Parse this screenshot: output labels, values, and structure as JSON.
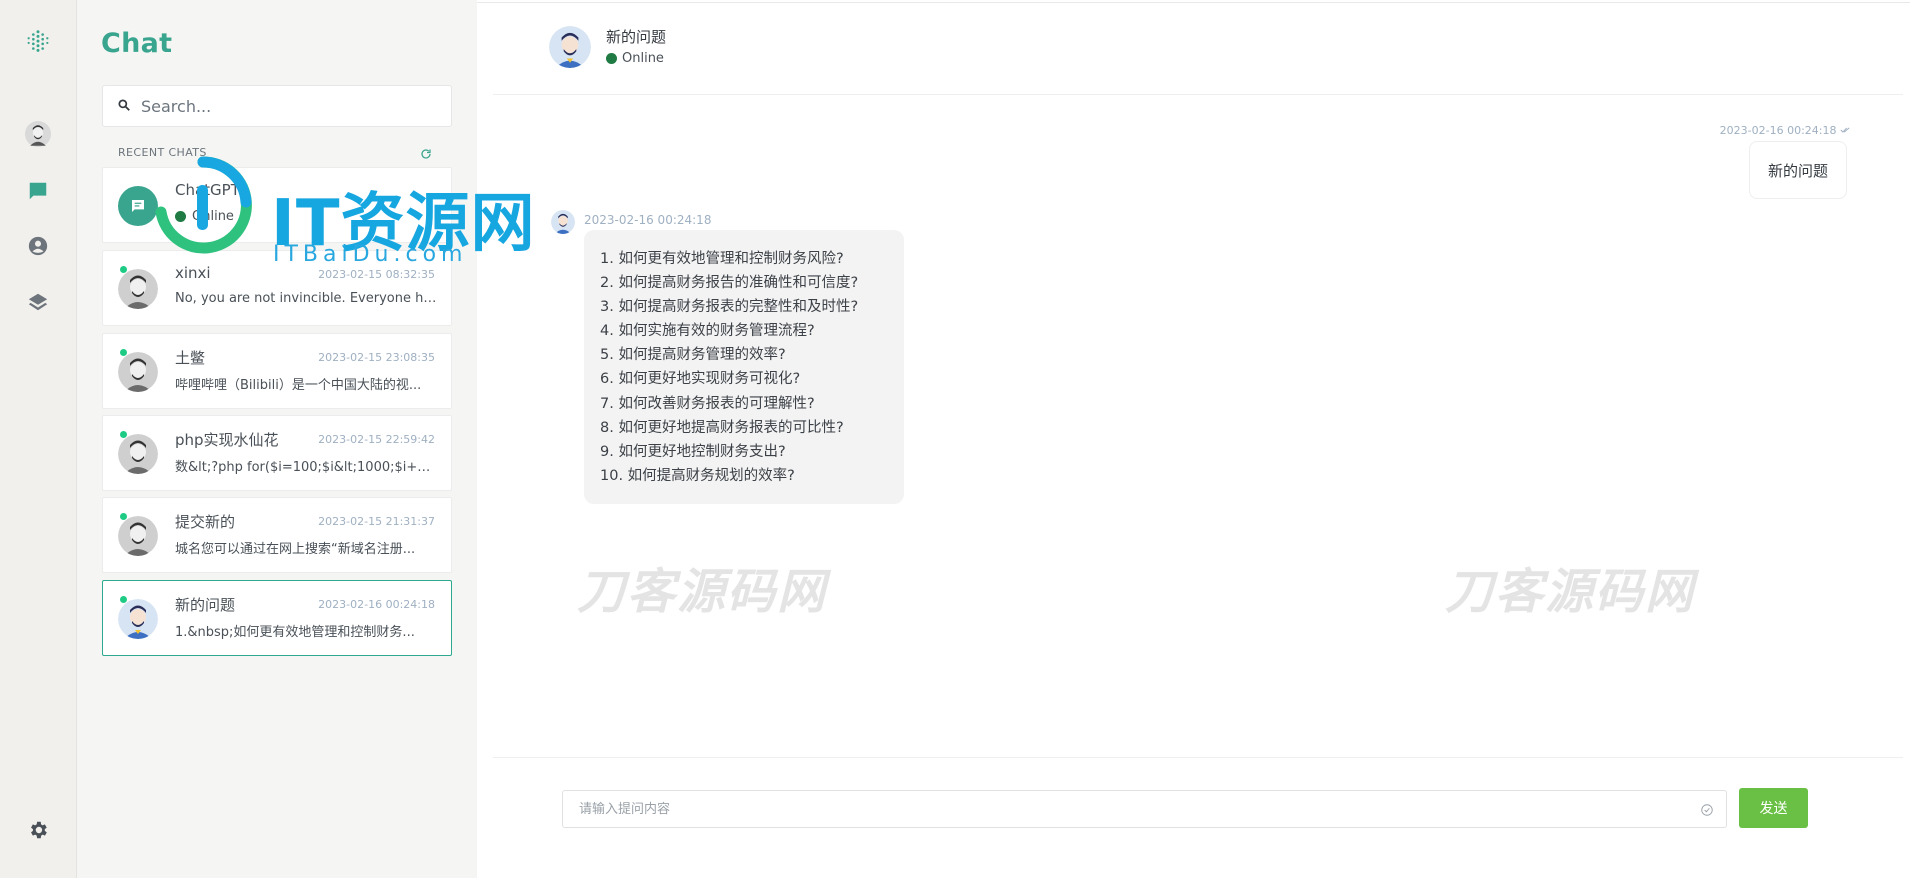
{
  "colors": {
    "accent": "#3aa58f",
    "send": "#6ac044",
    "online": "#1f7a43",
    "unread_dot": "#1ecb84"
  },
  "rail": {
    "icons": [
      "brand-icon",
      "profile-avatar",
      "chat-icon",
      "user-circle-icon",
      "layers-icon",
      "settings-icon"
    ]
  },
  "panel": {
    "title": "Chat",
    "search_placeholder": "Search...",
    "recent_label": "RECENT CHATS",
    "chats": [
      {
        "name": "ChatGPT",
        "status": "Online",
        "type": "bot"
      },
      {
        "name": "xinxi",
        "time": "2023-02-15 08:32:35",
        "preview": "No, you are not invincible. Everyone has..."
      },
      {
        "name": "土鳖",
        "time": "2023-02-15 23:08:35",
        "preview": "哔哩哔哩（Bilibili）是一个中国大陆的视..."
      },
      {
        "name": "php实现水仙花",
        "time": "2023-02-15 22:59:42",
        "preview": "数&lt;?php for($i=100;$i&lt;1000;$i++)..."
      },
      {
        "name": "提交新的",
        "time": "2023-02-15 21:31:37",
        "preview": "城名您可以通过在网上搜索“新域名注册..."
      },
      {
        "name": "新的问题",
        "time": "2023-02-16 00:24:18",
        "preview": "1.&nbsp;如何更有效地管理和控制财务...",
        "active": true
      }
    ]
  },
  "header": {
    "name": "新的问题",
    "status": "Online"
  },
  "messages": {
    "outgoing": {
      "time": "2023-02-16 00:24:18",
      "text": "新的问题"
    },
    "incoming": {
      "time": "2023-02-16 00:24:18",
      "lines": [
        "1. 如何更有效地管理和控制财务风险?",
        "2. 如何提高财务报告的准确性和可信度?",
        "3. 如何提高财务报表的完整性和及时性?",
        "4. 如何实施有效的财务管理流程?",
        "5. 如何提高财务管理的效率?",
        "6. 如何更好地实现财务可视化?",
        "7. 如何改善财务报表的可理解性?",
        "8. 如何更好地提高财务报表的可比性?",
        "9. 如何更好地控制财务支出?",
        "10. 如何提高财务规划的效率?"
      ]
    }
  },
  "watermarks": {
    "left": "刀客源码网",
    "right": "刀客源码网",
    "logo": "IT资源网",
    "logo_sub": "ITBaiDu.com"
  },
  "composer": {
    "placeholder": "请输入提问内容",
    "send_label": "发送"
  }
}
